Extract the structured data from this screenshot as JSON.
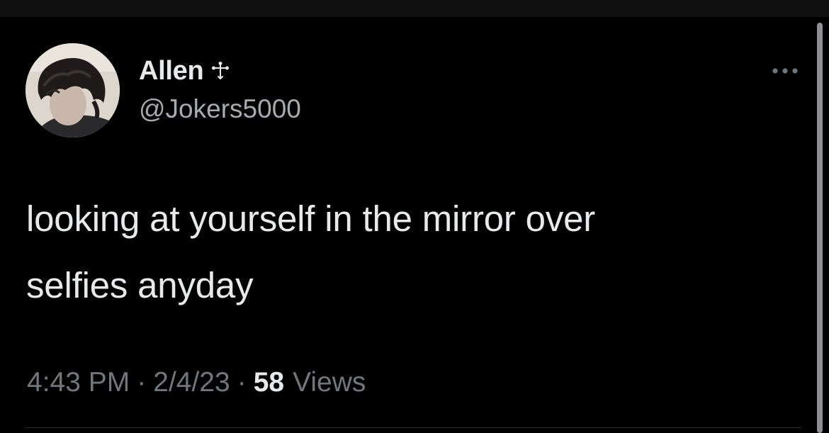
{
  "tweet": {
    "author": {
      "display_name": "Allen",
      "badge_icon": "cross-icon",
      "handle": "@Jokers5000",
      "avatar": "avatar-photo"
    },
    "text_line1": "looking at yourself in the mirror over",
    "text_line2": "selfies anyday",
    "time": "4:43 PM",
    "separator": "·",
    "date": "2/4/23",
    "views_count": "58",
    "views_label": "Views",
    "more_icon": "more-options-icon"
  },
  "colors": {
    "background": "#000000",
    "primary_text": "#e7e9ea",
    "secondary_text": "#71767b",
    "handle_text": "#a6abb0",
    "divider": "#2f3336"
  }
}
